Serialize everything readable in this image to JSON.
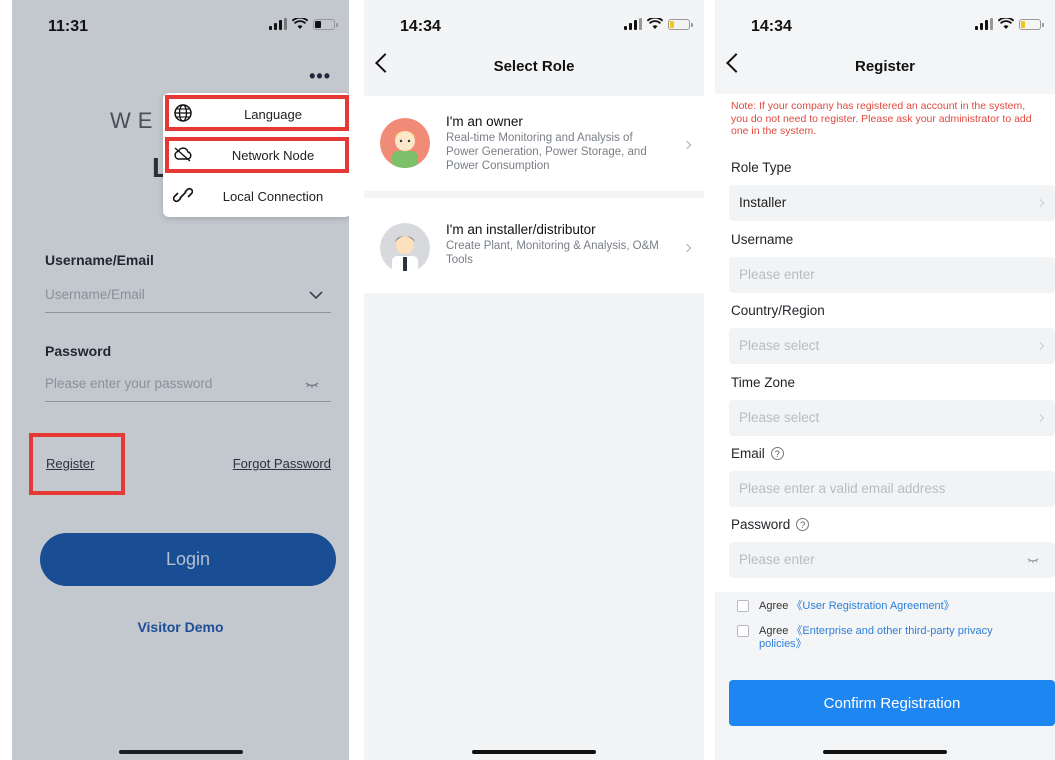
{
  "screen1": {
    "time": "11:31",
    "more_glyph": "•••",
    "welcome_partial": "WE",
    "welcome_letter": "L",
    "popup": {
      "items": [
        {
          "label": "Language",
          "icon": "globe-icon"
        },
        {
          "label": "Network Node",
          "icon": "cloud-icon"
        },
        {
          "label": "Local Connection",
          "icon": "link-icon"
        }
      ]
    },
    "username_label": "Username/Email",
    "username_placeholder": "Username/Email",
    "password_label": "Password",
    "password_placeholder": "Please enter your password",
    "register_link": "Register",
    "forgot_link": "Forgot Password",
    "login_button": "Login",
    "visitor_demo": "Visitor Demo",
    "colors": {
      "login_bg": "#1a4e94",
      "highlight": "#e53935",
      "visitor": "#1d4d96"
    }
  },
  "screen2": {
    "time": "14:34",
    "title": "Select Role",
    "roles": [
      {
        "title": "I'm an owner",
        "description": "Real-time Monitoring and Analysis of Power Generation, Power Storage, and Power Consumption",
        "icon": "owner-avatar"
      },
      {
        "title": "I'm an installer/distributor",
        "description": "Create Plant, Monitoring & Analysis, O&M Tools",
        "icon": "installer-avatar"
      }
    ]
  },
  "screen3": {
    "time": "14:34",
    "title": "Register",
    "note": "Note: If your company has registered an account in the system, you do not need to register. Please ask your administrator to add one in the system.",
    "fields": [
      {
        "label": "Role Type",
        "value": "Installer",
        "placeholder": "",
        "accessory": "chevron"
      },
      {
        "label": "Username",
        "value": "",
        "placeholder": "Please enter",
        "accessory": "none"
      },
      {
        "label": "Country/Region",
        "value": "",
        "placeholder": "Please select",
        "accessory": "chevron"
      },
      {
        "label": "Time Zone",
        "value": "",
        "placeholder": "Please select",
        "accessory": "chevron"
      },
      {
        "label": "Email",
        "value": "",
        "placeholder": "Please enter a valid email address",
        "accessory": "none",
        "help": true
      },
      {
        "label": "Password",
        "value": "",
        "placeholder": "Please enter",
        "accessory": "eye",
        "help": true
      }
    ],
    "agreements": [
      {
        "prefix": "Agree",
        "link": "《User Registration Agreement》"
      },
      {
        "prefix": "Agree",
        "link": "《Enterprise and other third-party privacy policies》"
      }
    ],
    "confirm_button": "Confirm Registration",
    "colors": {
      "note": "#e04a3f",
      "button": "#1d86f0",
      "link": "#2d7fd8"
    }
  }
}
